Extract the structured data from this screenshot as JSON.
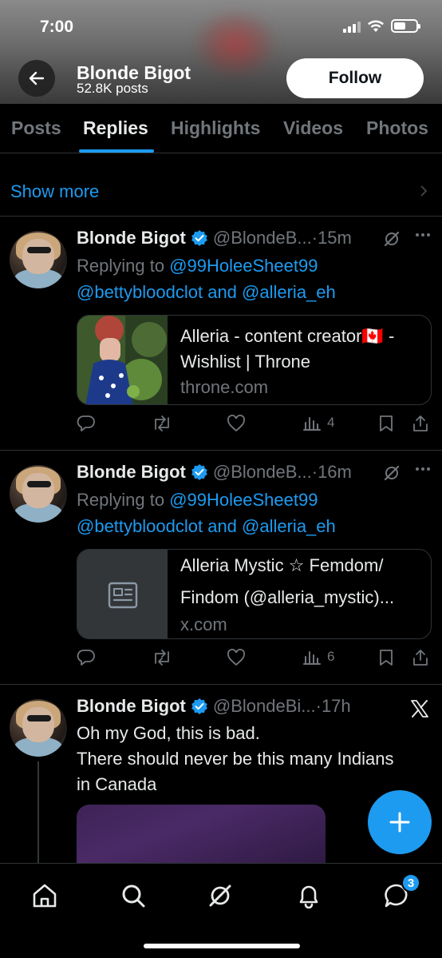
{
  "status_bar": {
    "time": "7:00"
  },
  "header": {
    "name": "Blonde Bigot",
    "posts": "52.8K posts",
    "follow_label": "Follow"
  },
  "tabs": [
    {
      "label": "Posts",
      "active": false
    },
    {
      "label": "Replies",
      "active": true
    },
    {
      "label": "Highlights",
      "active": false
    },
    {
      "label": "Videos",
      "active": false
    },
    {
      "label": "Photos",
      "active": false
    }
  ],
  "show_more": {
    "label": "Show more"
  },
  "tweets": [
    {
      "name": "Blonde Bigot",
      "handle": "@BlondeB...",
      "time": "15m",
      "replying_prefix": "Replying to ",
      "reply_to_1": "@99HoleeSheet99",
      "reply_to_2": "@bettybloodclot",
      "reply_and": " and ",
      "reply_to_3": "@alleria_eh",
      "card": {
        "title_line1": "Alleria - content creator🇨🇦 -",
        "title_line2": "Wishlist | Throne",
        "domain": "throne.com"
      },
      "views": "4"
    },
    {
      "name": "Blonde Bigot",
      "handle": "@BlondeB...",
      "time": "16m",
      "replying_prefix": "Replying to ",
      "reply_to_1": "@99HoleeSheet99",
      "reply_to_2": "@bettybloodclot",
      "reply_and": " and ",
      "reply_to_3": "@alleria_eh",
      "card": {
        "title_line1": "Alleria Mystic ☆ Femdom/",
        "title_line2": "Findom (@alleria_mystic)...",
        "domain": "x.com"
      },
      "views": "6"
    },
    {
      "name": "Blonde Bigot",
      "handle": "@BlondeBi...",
      "time": "17h",
      "text_line1": "Oh my God, this is bad.",
      "text_line2": "There should never be this many Indians",
      "text_line3": "in Canada"
    }
  ],
  "separator": " · ",
  "bottom_nav": {
    "items": [
      "home-icon",
      "search-icon",
      "grok-icon",
      "notifications-icon",
      "messages-icon"
    ],
    "messages_badge": "3"
  },
  "colors": {
    "accent": "#1d9bf0",
    "muted": "#71767b",
    "text": "#e7e9ea",
    "divider": "#2f3336"
  }
}
